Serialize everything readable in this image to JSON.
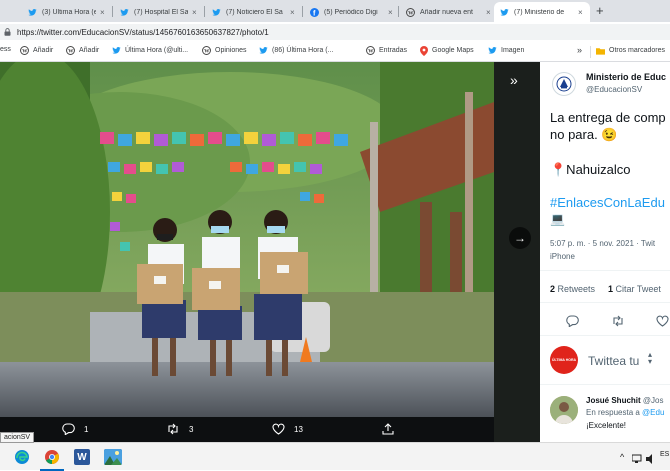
{
  "browser": {
    "tabs": [
      {
        "label": "(3) Última Hora (e",
        "icon": "twitter-icon"
      },
      {
        "label": "(7) Hospital El Sal",
        "icon": "twitter-icon"
      },
      {
        "label": "(7) Noticiero El Sa",
        "icon": "twitter-icon"
      },
      {
        "label": "(5) Periódico Digi",
        "icon": "facebook-icon"
      },
      {
        "label": "Añadir nueva ent",
        "icon": "wordpress-icon"
      },
      {
        "label": "(7) Ministerio de",
        "icon": "twitter-icon",
        "active": true
      }
    ],
    "url": "https://twitter.com/EducacionSV/status/1456760163650637827/photo/1",
    "bookmarks": [
      {
        "label": "ess",
        "icon": "none"
      },
      {
        "label": "Añadir",
        "icon": "wordpress-icon"
      },
      {
        "label": "Añadir",
        "icon": "wordpress-icon"
      },
      {
        "label": "Última Hora (@ulti...",
        "icon": "twitter-icon"
      },
      {
        "label": "Opiniones",
        "icon": "wordpress-icon"
      },
      {
        "label": "(86) Última Hora (...",
        "icon": "twitter-icon"
      },
      {
        "label": "Entradas",
        "icon": "wordpress-icon"
      },
      {
        "label": "Google Maps",
        "icon": "maps-icon"
      },
      {
        "label": "Imagen",
        "icon": "twitter-icon"
      }
    ],
    "bookmarks_more": "»",
    "other_bookmarks": "Otros marcadores"
  },
  "photo_actions": {
    "replies": "1",
    "retweets": "3",
    "likes": "13"
  },
  "tweet": {
    "author_name": "Ministerio de Educ",
    "author_handle": "@EducacionSV",
    "text_line1": "La entrega de comp",
    "text_line2": "no para. 😉",
    "location": "📍Nahuizalco",
    "hashtag": "#EnlacesConLaEdu",
    "laptop": "💻",
    "meta": "5:07 p. m. · 5 nov. 2021 · Twit",
    "source": "iPhone",
    "retweets_count": "2",
    "retweets_label": "Retweets",
    "quotes_count": "1",
    "quotes_label": "Citar Tweet",
    "reply_placeholder": "Twittea tu",
    "reply_avatar_text": "ÚLTIMA HORA",
    "replier_name": "Josué Shuchit",
    "replier_handle": "@Jos",
    "replying_to_label": "En respuesta a",
    "replying_to_handle": "@Edu",
    "reply_text": "¡Excelente!"
  },
  "taskbar": {
    "tooltip": "acionSV",
    "tray": "ES"
  },
  "colors": {
    "twitter_blue": "#1d9bf0",
    "chrome_tabbar": "#dee1e6",
    "viewer_bg": "#0d0f11"
  }
}
